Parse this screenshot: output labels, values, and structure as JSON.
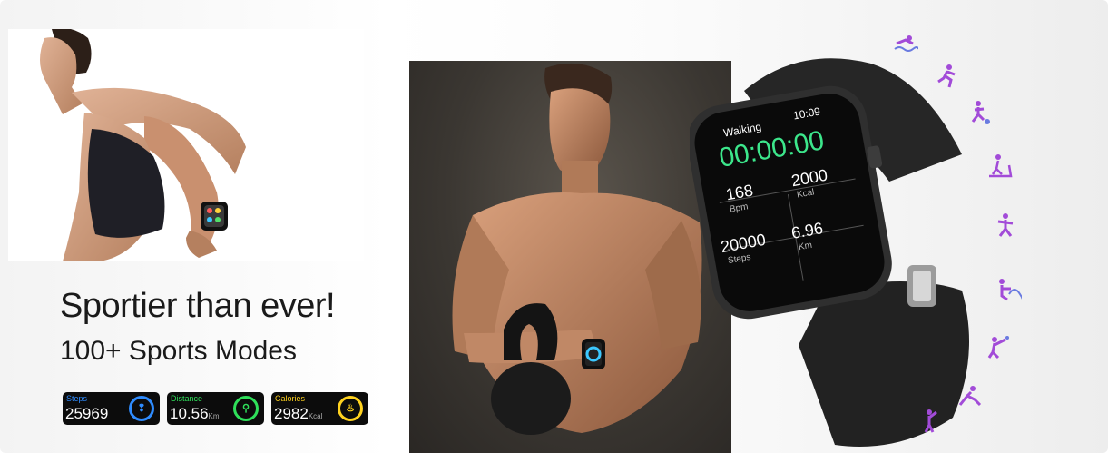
{
  "headline": "Sportier than ever!",
  "subline": "100+ Sports Modes",
  "stats": [
    {
      "label": "Steps",
      "value": "25969",
      "unit": "",
      "color": "#2f8cff",
      "icon": "footsteps-icon",
      "glyph": "❢"
    },
    {
      "label": "Distance",
      "value": "10.56",
      "unit": "Km",
      "color": "#2fe05a",
      "icon": "location-icon",
      "glyph": "⚲"
    },
    {
      "label": "Calories",
      "value": "2982",
      "unit": "Kcal",
      "color": "#ffd21f",
      "icon": "flame-icon",
      "glyph": "♨"
    }
  ],
  "watch": {
    "mode": "Walking",
    "time": "10:09",
    "timer": "00:00:00",
    "metrics": [
      {
        "value": "168",
        "unit": "Bpm"
      },
      {
        "value": "2000",
        "unit": "Kcal"
      },
      {
        "value": "20000",
        "unit": "Steps"
      },
      {
        "value": "6.96",
        "unit": "Km"
      }
    ],
    "timer_color": "#3ce68b"
  },
  "sport_icons": [
    "swimming-icon",
    "running-icon",
    "football-icon",
    "treadmill-icon",
    "dancing-icon",
    "yoga-icon",
    "badminton-icon",
    "stretching-icon",
    "cricket-icon"
  ],
  "icon_color": "#a24bd8"
}
